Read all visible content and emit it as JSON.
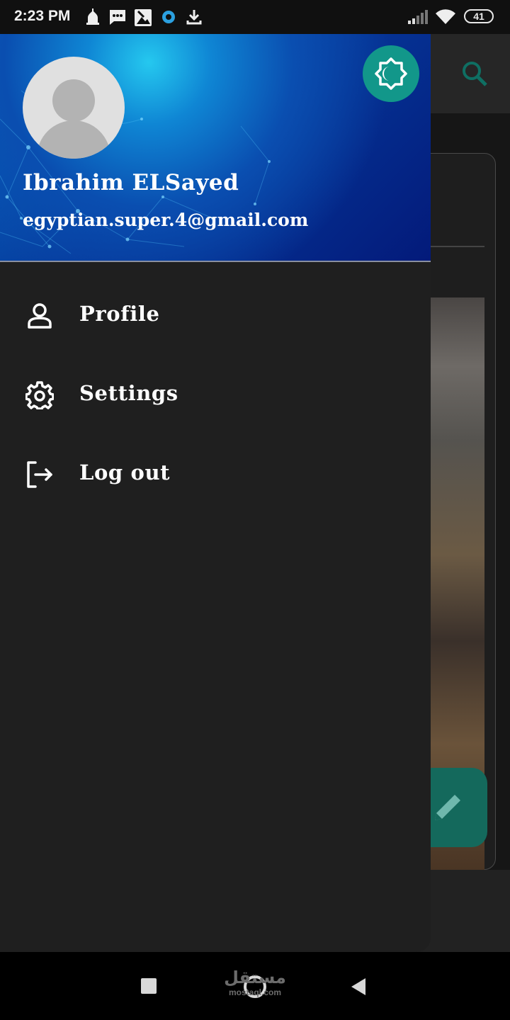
{
  "status_bar": {
    "time": "2:23 PM",
    "battery_level": "41",
    "notification_icons": [
      "mosque-icon",
      "message-icon",
      "image-icon",
      "record-icon",
      "download-icon"
    ],
    "system_icons": [
      "signal-icon",
      "wifi-icon",
      "battery-icon"
    ]
  },
  "drawer": {
    "header": {
      "user_name": "Ibrahim ELSayed",
      "user_email": "egyptian.super.4@gmail.com",
      "theme_toggle_icon": "brightness-moon-icon",
      "accent_color": "#12978a"
    },
    "menu": [
      {
        "label": "Profile",
        "icon": "person-icon"
      },
      {
        "label": "Settings",
        "icon": "gear-icon"
      },
      {
        "label": "Log out",
        "icon": "logout-icon"
      }
    ]
  },
  "background_app": {
    "search_icon": "search-icon",
    "fab_icon": "pencil-icon"
  },
  "nav_bar": {
    "buttons": [
      "recents-button",
      "home-button",
      "back-button"
    ]
  },
  "watermark": {
    "logo": "مستقل",
    "text": "mostaql.com"
  }
}
